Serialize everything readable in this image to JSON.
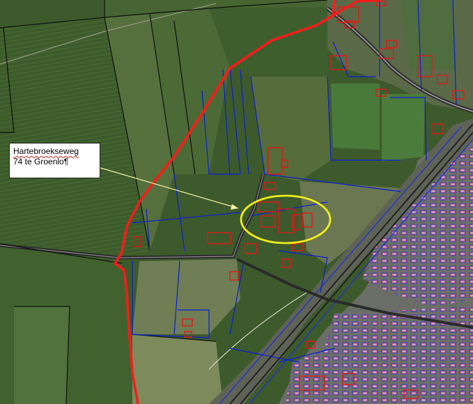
{
  "map": {
    "type": "aerial cadastral map overlay",
    "colors": {
      "field_dark": "#2f4a24",
      "field_mid": "#4a6a33",
      "field_light": "#6f7d50",
      "urban": "#6d6f66",
      "road": "#2a2a2a",
      "parcel_line": "#0b1ed8",
      "field_line": "#111111",
      "building_outline": "#e01818",
      "municipal_border": "#ff1a1a",
      "highlight_ellipse": "#f2ec1a",
      "leader_line": "#f5f0a0"
    }
  },
  "callout": {
    "line1": "Hartebroekseweg",
    "line2": "74 te Groenlo¶"
  }
}
